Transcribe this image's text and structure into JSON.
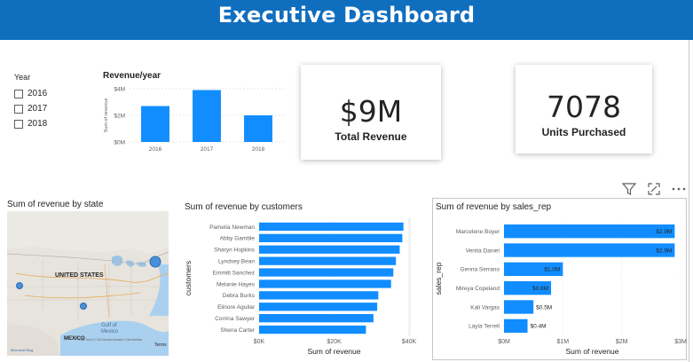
{
  "header": {
    "title": "Executive Dashboard"
  },
  "colors": {
    "header": "#106ebe",
    "bar": "#118dff",
    "accent_map": "#4a90d9"
  },
  "slicer": {
    "title": "Year",
    "options": [
      "2016",
      "2017",
      "2018"
    ]
  },
  "revenue_year": {
    "title": "Revenue/year",
    "y_axis_label": "Sum of revenue",
    "chart_data": {
      "type": "bar",
      "categories": [
        "2016",
        "2017",
        "2018"
      ],
      "values": [
        2.7,
        3.9,
        2.0
      ],
      "ylim": [
        0,
        4
      ],
      "ytick_labels": [
        "$0M",
        "$2M",
        "$4M"
      ],
      "grid": true
    }
  },
  "total_revenue": {
    "value": "$9M",
    "label": "Total Revenue"
  },
  "units_purchased": {
    "value": "7078",
    "label": "Units Purchased"
  },
  "state_map": {
    "title": "Sum of revenue by state",
    "country_label": "UNITED STATES",
    "gulf_label": "Gulf of\nMexico",
    "mexico_label": "MEXICO",
    "attribution": "© 2022 TomTom, © 2022 Microsoft Corporation, © OpenStreetMap",
    "terms": "Terms",
    "bing": "Microsoft Bing"
  },
  "customers": {
    "title": "Sum of revenue by customers",
    "xlabel": "Sum of revenue",
    "ylabel": "customers",
    "chart_data": {
      "type": "bar",
      "orientation": "horizontal",
      "categories": [
        "Pamelia Newman",
        "Abby Gamble",
        "Sharyn Hopkins",
        "Lyndsey Bean",
        "Emmitt Sanchez",
        "Melanie Hayes",
        "Debra Burks",
        "Elinore Aguilar",
        "Corrina Sawyer",
        "Shena Carter"
      ],
      "values": [
        38.5,
        38.2,
        37.5,
        36.5,
        35.8,
        35.2,
        31.8,
        31.5,
        30.5,
        28.5
      ],
      "xlim": [
        0,
        40
      ],
      "xtick_labels": [
        "$0K",
        "$20K",
        "$40K"
      ],
      "xlabel": "Sum of revenue",
      "ylabel": "customers"
    }
  },
  "sales_rep": {
    "title": "Sum of revenue by sales_rep",
    "xlabel": "Sum of revenue",
    "ylabel": "sales_rep",
    "chart_data": {
      "type": "bar",
      "orientation": "horizontal",
      "categories": [
        "Marcelene Boyer",
        "Venita Daniel",
        "Genna Serrano",
        "Mireya Copeland",
        "Kali Vargas",
        "Layla Terrell"
      ],
      "values": [
        2.9,
        2.9,
        1.0,
        0.8,
        0.5,
        0.4
      ],
      "data_labels": [
        "$2.9M",
        "$2.9M",
        "$1.0M",
        "$0.8M",
        "$0.5M",
        "$0.4M"
      ],
      "xlim": [
        0,
        3
      ],
      "xtick_labels": [
        "$0M",
        "$1M",
        "$2M",
        "$3M"
      ],
      "xlabel": "Sum of revenue",
      "ylabel": "sales_rep"
    }
  },
  "visual_header": {
    "icons": [
      "filter-icon",
      "focus-mode-icon",
      "more-options-icon"
    ]
  }
}
